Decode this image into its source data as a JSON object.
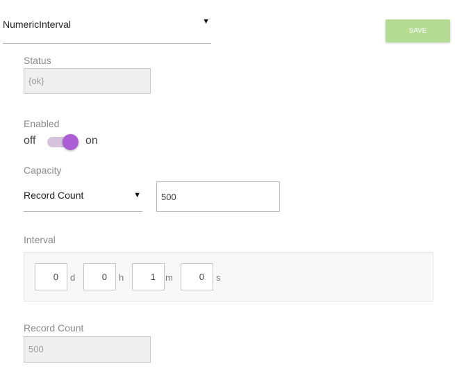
{
  "header": {
    "type_select": {
      "value": "NumericInterval",
      "arrow": "▼"
    },
    "save_label": "SAVE"
  },
  "status": {
    "label": "Status",
    "value": "{ok}"
  },
  "enabled": {
    "label": "Enabled",
    "off_label": "off",
    "on_label": "on",
    "checked": true
  },
  "capacity": {
    "label": "Capacity",
    "select": {
      "value": "Record Count",
      "arrow": "▼"
    },
    "input_value": "500"
  },
  "interval": {
    "label": "Interval",
    "fields": [
      {
        "value": "0",
        "unit": "d"
      },
      {
        "value": "0",
        "unit": "h"
      },
      {
        "value": "1",
        "unit": "m"
      },
      {
        "value": "0",
        "unit": "s"
      }
    ]
  },
  "record_count": {
    "label": "Record Count",
    "value": "500"
  },
  "colors": {
    "save_button": "#b5dc93",
    "toggle_thumb": "#ab5cd6",
    "toggle_track": "#d5c3dc"
  }
}
